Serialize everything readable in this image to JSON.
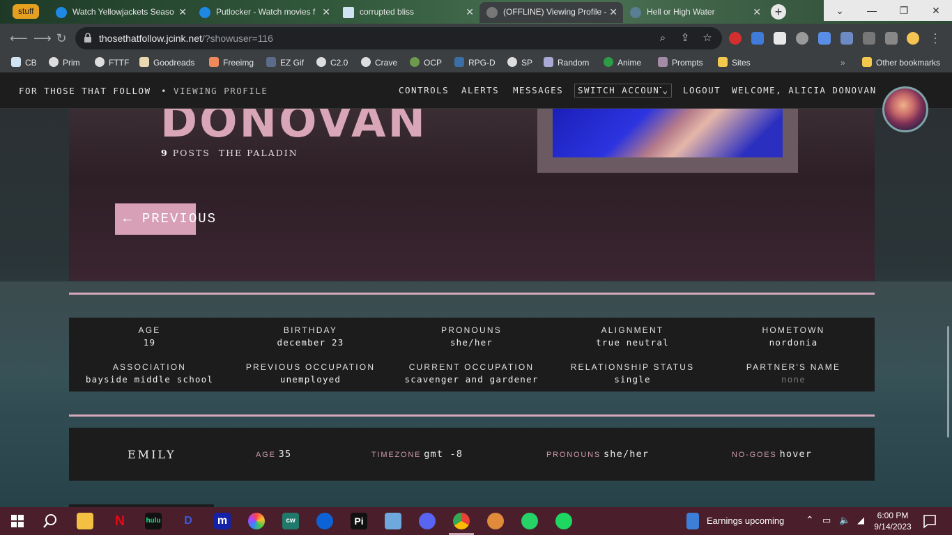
{
  "browser": {
    "tab_group_label": "stuff",
    "tabs": [
      {
        "title": "Watch Yellowjackets Seaso",
        "active": false
      },
      {
        "title": "Putlocker - Watch movies f",
        "active": false
      },
      {
        "title": "corrupted bliss",
        "active": false
      },
      {
        "title": "(OFFLINE) Viewing Profile -",
        "active": true
      },
      {
        "title": "Hell or High Water",
        "active": false
      }
    ],
    "url_host": "thosethatfollow.jcink.net",
    "url_path": "/?showuser=116",
    "bookmarks": [
      "CB",
      "Prim",
      "FTTF",
      "Goodreads",
      "Freeimg",
      "EZ Gif",
      "C2.0",
      "Crave",
      "OCP",
      "RPG-D",
      "SP",
      "Random",
      "Anime",
      "Prompts",
      "Sites"
    ],
    "other_bookmarks": "Other bookmarks",
    "overflow": "»"
  },
  "site_nav": {
    "brand": "FOR THOSE THAT FOLLOW",
    "separator": "•",
    "crumb": "VIEWING PROFILE",
    "controls": "CONTROLS",
    "alerts": "ALERTS",
    "messages": "MESSAGES",
    "switch_account": "SWITCH ACCOUNT",
    "logout": "LOGOUT",
    "welcome": "WELCOME, ALICIA DONOVAN"
  },
  "profile": {
    "surname": "DONOVAN",
    "posts_count": "9",
    "posts_label": "POSTS",
    "title": "THE PALADIN",
    "previous_label": "PREVIOUS",
    "fields": [
      {
        "label": "AGE",
        "value": "19"
      },
      {
        "label": "BIRTHDAY",
        "value": "december 23"
      },
      {
        "label": "PRONOUNS",
        "value": "she/her"
      },
      {
        "label": "ALIGNMENT",
        "value": "true neutral"
      },
      {
        "label": "HOMETOWN",
        "value": "nordonia"
      },
      {
        "label": "ASSOCIATION",
        "value": "bayside middle school"
      },
      {
        "label": "PREVIOUS OCCUPATION",
        "value": "unemployed"
      },
      {
        "label": "CURRENT OCCUPATION",
        "value": "scavenger and gardener"
      },
      {
        "label": "RELATIONSHIP STATUS",
        "value": "single"
      },
      {
        "label": "PARTNER'S NAME",
        "value": "none"
      }
    ]
  },
  "player": {
    "name": "EMILY",
    "age_label": "AGE",
    "age": "35",
    "timezone_label": "TIMEZONE",
    "timezone": "gmt -8",
    "pronouns_label": "PRONOUNS",
    "pronouns": "she/her",
    "nogoes_label": "NO-GOES",
    "nogoes": "hover"
  },
  "taskbar": {
    "weather_text": "Earnings upcoming",
    "time": "6:00 PM",
    "date": "9/14/2023",
    "apps": [
      "start-icon",
      "search-icon",
      "file-explorer-icon",
      "netflix-icon",
      "hulu-icon",
      "disney-plus-icon",
      "max-icon",
      "photos-icon",
      "cw-icon",
      "paramount-icon",
      "pi-icon",
      "image-viewer-icon",
      "discord-icon",
      "chrome-icon",
      "game-icon",
      "whatsapp-icon",
      "spotify-icon"
    ],
    "app_labels": {
      "hulu": "hulu",
      "max": "m",
      "cw": "cw",
      "pi": "Pi"
    }
  },
  "colors": {
    "accent_pink": "#d8a0b7",
    "taskbar": "#4a1e2b",
    "panel": "#1c1c1c"
  }
}
